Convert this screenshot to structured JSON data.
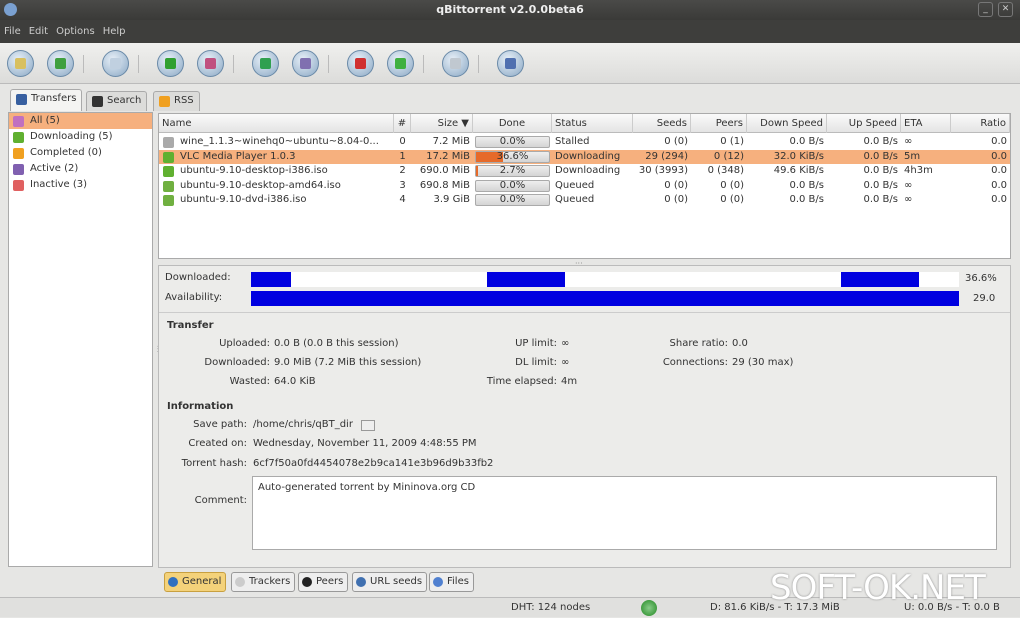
{
  "window": {
    "title": "qBittorrent v2.0.0beta6",
    "buttons": [
      "_",
      "✕"
    ]
  },
  "menu": [
    "File",
    "Edit",
    "Options",
    "Help"
  ],
  "toolbar": [
    {
      "name": "add-torrent-file",
      "color": "#d8c060"
    },
    {
      "name": "add-torrent-link",
      "color": "#40a040"
    },
    {
      "name": "delete",
      "color": "#c0d0e0"
    },
    {
      "name": "start",
      "color": "#30a030"
    },
    {
      "name": "pause",
      "color": "#c05080"
    },
    {
      "name": "start-all",
      "color": "#30a050"
    },
    {
      "name": "pause-all",
      "color": "#8070b0"
    },
    {
      "name": "decrease-priority",
      "color": "#d03030"
    },
    {
      "name": "increase-priority",
      "color": "#40b040"
    },
    {
      "name": "preferences",
      "color": "#c0c8d0"
    },
    {
      "name": "exit",
      "color": "#5070b0"
    }
  ],
  "tabs": [
    {
      "label": "Transfers",
      "color": "#3860a0"
    },
    {
      "label": "Search",
      "color": "#333333"
    },
    {
      "label": "RSS",
      "color": "#f0a020"
    }
  ],
  "filters": [
    {
      "label": "All (5)",
      "color": "#c070c0",
      "selected": true
    },
    {
      "label": "Downloading (5)",
      "color": "#60b030"
    },
    {
      "label": "Completed (0)",
      "color": "#f0a020"
    },
    {
      "label": "Active (2)",
      "color": "#8060b0"
    },
    {
      "label": "Inactive (3)",
      "color": "#e06060"
    }
  ],
  "columns": [
    "Name",
    "#",
    "Size ▼",
    "Done",
    "Status",
    "Seeds",
    "Peers",
    "Down Speed",
    "Up Speed",
    "ETA",
    "Ratio"
  ],
  "torrents": [
    {
      "name": "wine_1.1.3~winehq0~ubuntu~8.04-0...",
      "num": "0",
      "size": "7.2 MiB",
      "done": "0.0%",
      "progress": 0,
      "status": "Stalled",
      "seeds": "0 (0)",
      "peers": "0 (1)",
      "down": "0.0 B/s",
      "up": "0.0 B/s",
      "eta": "∞",
      "ratio": "0.0",
      "icon": "#aaaaaa"
    },
    {
      "name": "VLC Media Player 1.0.3",
      "num": "1",
      "size": "17.2 MiB",
      "done": "36.6%",
      "progress": 36.6,
      "status": "Downloading",
      "seeds": "29 (294)",
      "peers": "0 (12)",
      "down": "32.0 KiB/s",
      "up": "0.0 B/s",
      "eta": "5m",
      "ratio": "0.0",
      "icon": "#60b030",
      "selected": true
    },
    {
      "name": "ubuntu-9.10-desktop-i386.iso",
      "num": "2",
      "size": "690.0 MiB",
      "done": "2.7%",
      "progress": 2.7,
      "status": "Downloading",
      "seeds": "30 (3993)",
      "peers": "0 (348)",
      "down": "49.6 KiB/s",
      "up": "0.0 B/s",
      "eta": "4h3m",
      "ratio": "0.0",
      "icon": "#60b030"
    },
    {
      "name": "ubuntu-9.10-desktop-amd64.iso",
      "num": "3",
      "size": "690.8 MiB",
      "done": "0.0%",
      "progress": 0,
      "status": "Queued",
      "seeds": "0 (0)",
      "peers": "0 (0)",
      "down": "0.0 B/s",
      "up": "0.0 B/s",
      "eta": "∞",
      "ratio": "0.0",
      "icon": "#70b040"
    },
    {
      "name": "ubuntu-9.10-dvd-i386.iso",
      "num": "4",
      "size": "3.9 GiB",
      "done": "0.0%",
      "progress": 0,
      "status": "Queued",
      "seeds": "0 (0)",
      "peers": "0 (0)",
      "down": "0.0 B/s",
      "up": "0.0 B/s",
      "eta": "∞",
      "ratio": "0.0",
      "icon": "#70b040"
    }
  ],
  "details": {
    "downloaded_label": "Downloaded:",
    "downloaded_pct": "36.6%",
    "downloaded_pieces": [
      [
        0,
        5.6
      ],
      [
        33.3,
        44.4
      ],
      [
        83.3,
        94.4
      ]
    ],
    "availability_label": "Availability:",
    "availability_value": "29.0",
    "availability_fraction": 1.0,
    "transfer_title": "Transfer",
    "uploaded_label": "Uploaded:",
    "uploaded": "0.0 B (0.0 B this session)",
    "dl_label": "Downloaded:",
    "dl": "9.0 MiB (7.2 MiB this session)",
    "wasted_label": "Wasted:",
    "wasted": "64.0 KiB",
    "up_limit_label": "UP limit:",
    "up_limit": "∞",
    "dl_limit_label": "DL limit:",
    "dl_limit": "∞",
    "elapsed_label": "Time elapsed:",
    "elapsed": "4m",
    "ratio_label": "Share ratio:",
    "ratio": "0.0",
    "conn_label": "Connections:",
    "conn": "29 (30 max)",
    "info_title": "Information",
    "path_label": "Save path:",
    "path": "/home/chris/qBT_dir",
    "created_label": "Created on:",
    "created": "Wednesday, November 11, 2009 4:48:55 PM",
    "hash_label": "Torrent hash:",
    "hash": "6cf7f50a0fd4454078e2b9ca141e3b96d9b33fb2",
    "comment_label": "Comment:",
    "comment": "Auto-generated torrent by Mininova.org CD"
  },
  "bottom_tabs": [
    {
      "label": "General",
      "color": "#3070c0",
      "active": true
    },
    {
      "label": "Trackers",
      "color": "#ccc"
    },
    {
      "label": "Peers",
      "color": "#222"
    },
    {
      "label": "URL seeds",
      "color": "#4070b0"
    },
    {
      "label": "Files",
      "color": "#5080d0"
    }
  ],
  "status": {
    "dht": "DHT: 124 nodes",
    "down": "D: 81.6 KiB/s - T: 17.3 MiB",
    "up": "U: 0.0 B/s - T: 0.0 B"
  },
  "watermark": "SOFT-OK.NET"
}
